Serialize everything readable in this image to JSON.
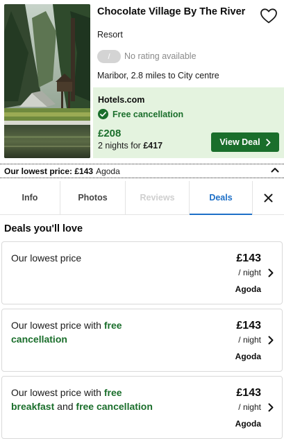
{
  "hotel": {
    "name": "Chocolate Village By The River",
    "type": "Resort",
    "rating_placeholder": "/",
    "rating_text": "No rating available",
    "location": "Maribor, 2.8 miles to City centre",
    "favorite_icon": "heart-outline-icon"
  },
  "featured_deal": {
    "provider": "Hotels.com",
    "free_cancellation": "Free cancellation",
    "price": "£208",
    "total_prefix": "2 nights for ",
    "total_amount": "£417",
    "button_label": "View Deal",
    "accent_color": "#1a6e2b",
    "background_color": "#e4f3df"
  },
  "lowest_price_bar": {
    "label": "Our lowest price: £143",
    "provider": "Agoda",
    "caret_icon": "chevron-up-icon"
  },
  "tabs": [
    {
      "label": "Info",
      "state": "normal"
    },
    {
      "label": "Photos",
      "state": "normal"
    },
    {
      "label": "Reviews",
      "state": "disabled"
    },
    {
      "label": "Deals",
      "state": "active"
    }
  ],
  "tab_close_icon": "close-icon",
  "tab_active_color": "#1d6fc7",
  "deals_section": {
    "heading": "Deals you'll love",
    "deals": [
      {
        "desc_prefix": "Our lowest price",
        "desc_b1": "",
        "desc_mid": "",
        "desc_b2": "",
        "price": "£143",
        "per": "/ night",
        "provider": "Agoda"
      },
      {
        "desc_prefix": "Our lowest price with ",
        "desc_b1": "free cancellation",
        "desc_mid": "",
        "desc_b2": "",
        "price": "£143",
        "per": "/ night",
        "provider": "Agoda"
      },
      {
        "desc_prefix": "Our lowest price with ",
        "desc_b1": "free breakfast",
        "desc_mid": " and ",
        "desc_b2": "free cancellation",
        "price": "£143",
        "per": "/ night",
        "provider": "Agoda"
      }
    ]
  }
}
